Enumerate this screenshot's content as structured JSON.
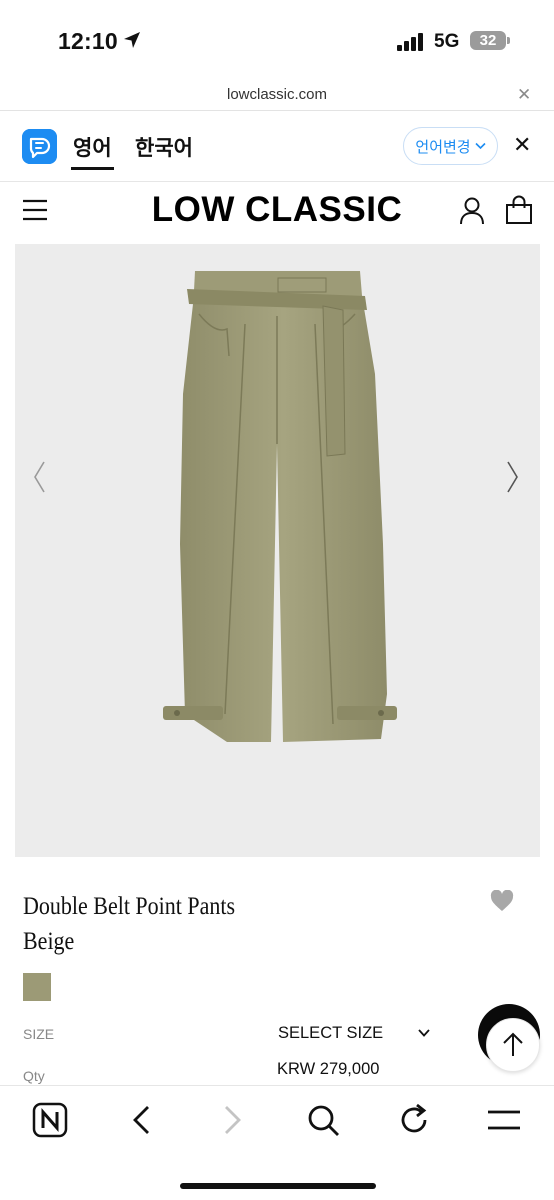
{
  "status_bar": {
    "time": "12:10",
    "network": "5G",
    "battery": "32",
    "icons": [
      "location-arrow-icon",
      "signal-icon",
      "battery-icon"
    ]
  },
  "browser": {
    "url": "lowclassic.com",
    "close_icon": "close-icon"
  },
  "translate_bar": {
    "icon": "translate-icon",
    "lang_source": "영어",
    "lang_target": "한국어",
    "change_label": "언어변경",
    "accent_color": "#1d8cf2"
  },
  "header": {
    "logo": "LOW CLASSIC",
    "icons": [
      "menu-icon",
      "user-icon",
      "bag-icon"
    ]
  },
  "product": {
    "name": "Double Belt Point Pants",
    "color_name": "Beige",
    "swatch_color": "#9c9a76",
    "size_label": "SIZE",
    "size_select": "SELECT SIZE",
    "qty_label": "Qty",
    "price": "KRW 279,000",
    "image_icons": [
      "chevron-left-icon",
      "chevron-right-icon"
    ],
    "wishlist_icon": "heart-icon"
  },
  "toolbar": {
    "icons": [
      "naver-icon",
      "back-icon",
      "forward-icon",
      "search-icon",
      "refresh-icon",
      "menu-icon"
    ]
  }
}
